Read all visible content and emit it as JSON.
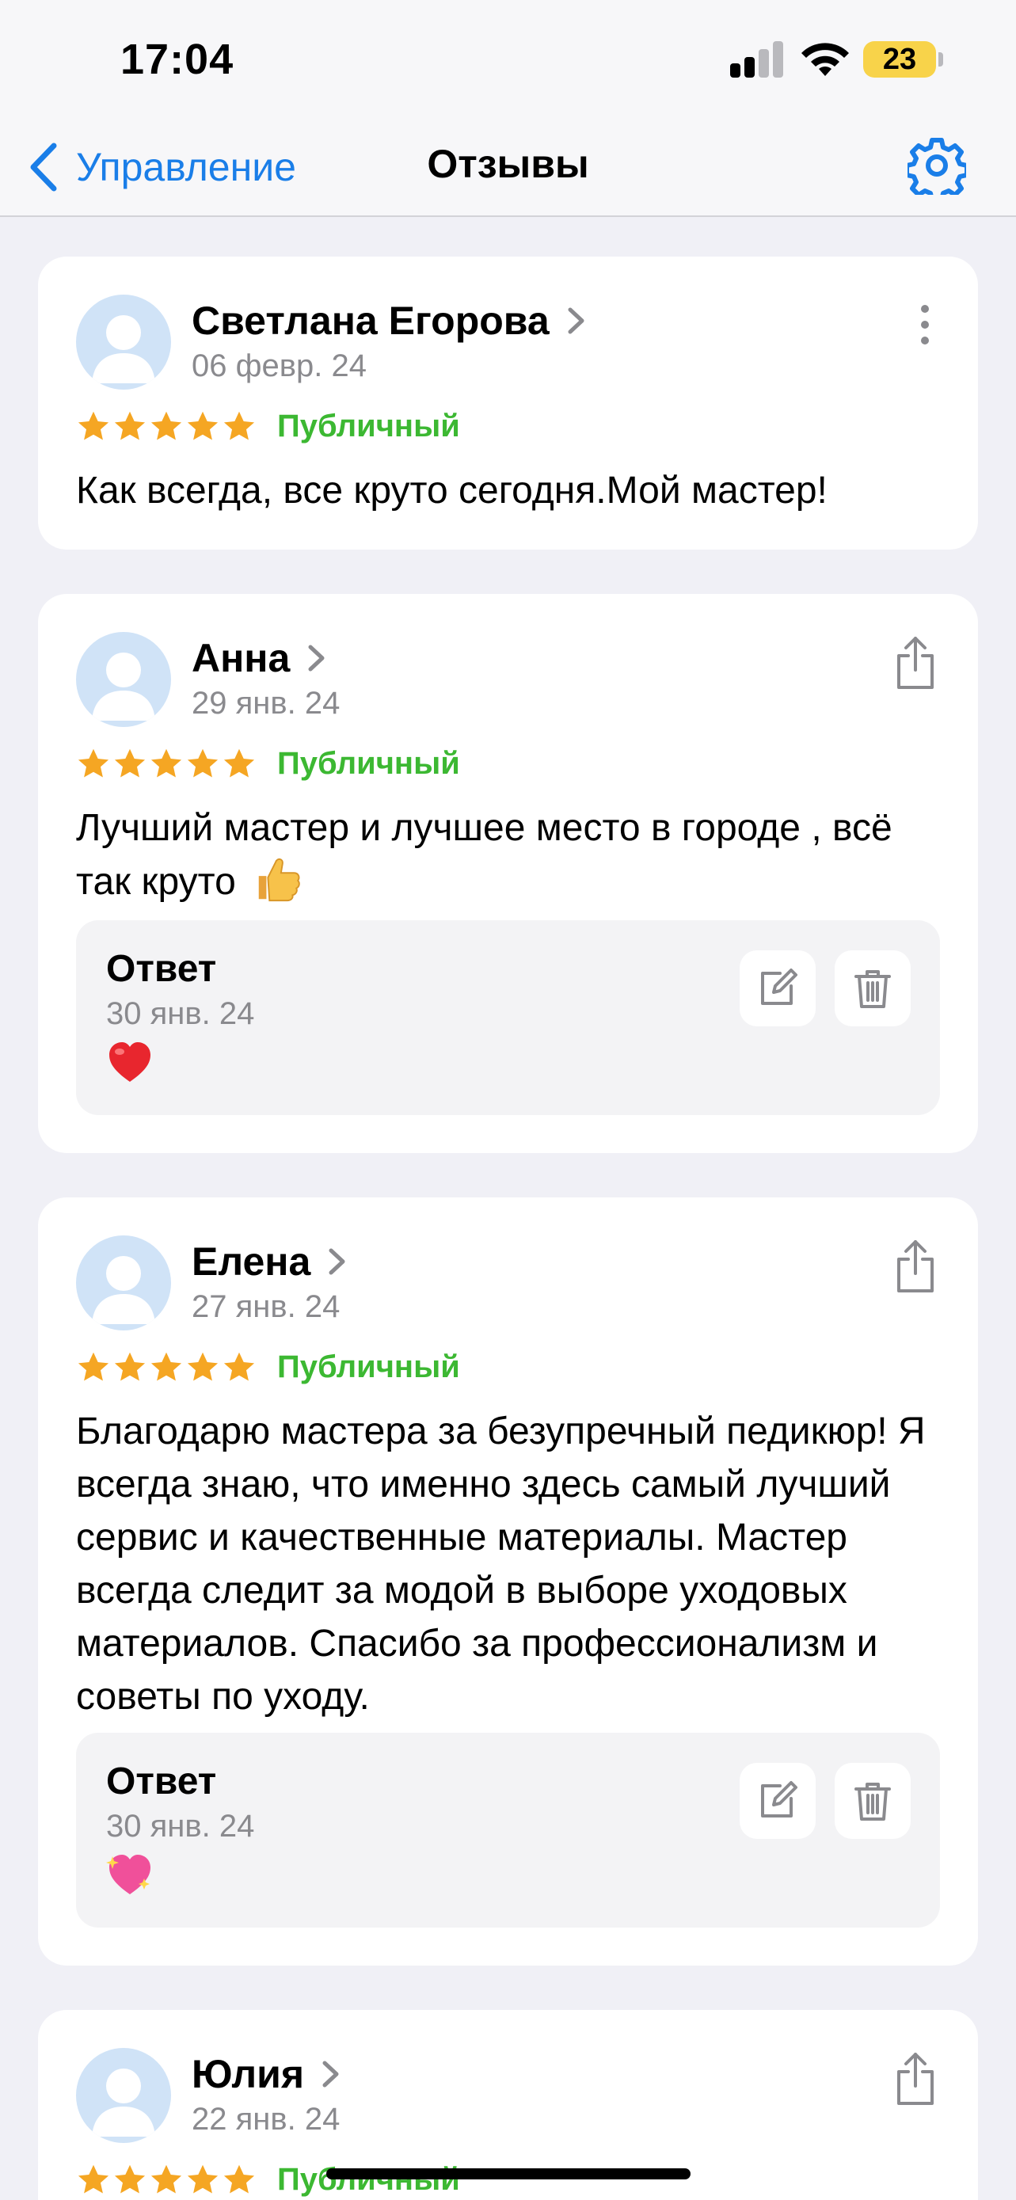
{
  "status_bar": {
    "time": "17:04",
    "battery": "23",
    "battery_color": "#f8d34a"
  },
  "nav": {
    "back_label": "Управление",
    "title": "Отзывы",
    "accent": "#1a7ee8"
  },
  "reviews": [
    {
      "name": "Светлана Егорова",
      "date": "06 февр. 24",
      "rating": 5,
      "status": "Публичный",
      "text": "Как всегда, все круто сегодня.Мой мастер!",
      "action_icon": "more-vertical-icon"
    },
    {
      "name": "Анна",
      "date": "29 янв. 24",
      "rating": 5,
      "status": "Публичный",
      "text": "Лучший мастер и лучшее место в городе , всё так круто",
      "text_emoji": "thumbs-up-emoji",
      "action_icon": "share-icon",
      "answer": {
        "title": "Ответ",
        "date": "30 янв. 24",
        "emoji": "red-heart-emoji"
      }
    },
    {
      "name": "Елена",
      "date": "27 янв. 24",
      "rating": 5,
      "status": "Публичный",
      "text": "Благодарю мастера за безупречный педикюр! Я всегда знаю, что именно здесь самый лучший сервис и качественные материалы. Мастер всегда следит за модой в выборе уходовых материалов. Спасибо за профессионализм и советы по уходу.",
      "action_icon": "share-icon",
      "answer": {
        "title": "Ответ",
        "date": "30 янв. 24",
        "emoji": "sparkling-heart-emoji"
      }
    },
    {
      "name": "Юлия",
      "date": "22 янв. 24",
      "rating": 5,
      "status": "Публичный",
      "action_icon": "share-icon"
    }
  ],
  "colors": {
    "star": "#f5a623",
    "public_status": "#3cb832",
    "background": "#f0f0f6"
  }
}
